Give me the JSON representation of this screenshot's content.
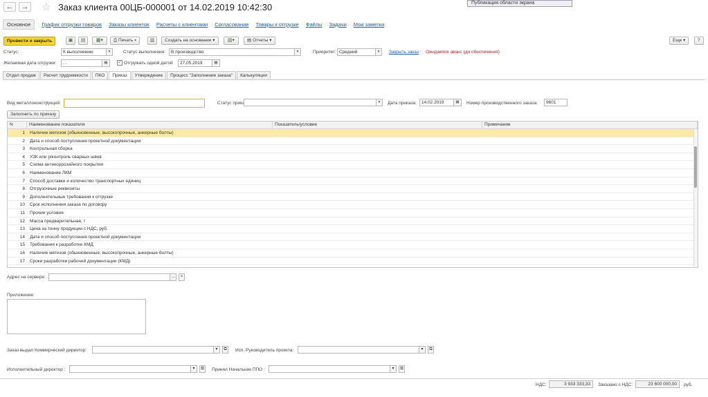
{
  "popup": {
    "text": "Публикация области экрана"
  },
  "window": {
    "title": "Заказ клиента 00ЦБ-000001 от 14.02.2019 10:42:30"
  },
  "nav": {
    "back": "←",
    "forward": "→",
    "star": "☆"
  },
  "top_tabs": [
    "Основное",
    "График отгрузки товаров",
    "Заказы клиентов",
    "Расчеты с клиентами",
    "Согласование",
    "Товары к отгрузке",
    "Файлы",
    "Задачи",
    "Мои заметки"
  ],
  "toolbar": {
    "post_close": "Провести и закрыть",
    "print": "Печать",
    "create_based": "Создать на основании",
    "reports": "Отчеты",
    "more": "Еще",
    "help": "?"
  },
  "status_row": {
    "status_label": "Статус:",
    "status_value": "К выполнению",
    "exec_label": "Статус выполнения:",
    "exec_value": "В производство",
    "priority_label": "Приоритет:",
    "priority_value": "Средний",
    "close_link": "Закрыть заказ",
    "warning": "Ожидается аванс (до обеспечения)"
  },
  "date_row": {
    "label": "Желаемая дата отгрузки:",
    "value": ". .",
    "checkbox_label": "Отгружать одной датой",
    "date_value": "27.05.2019"
  },
  "sub_tabs": [
    "Отдел продаж",
    "Расчет трудоемкости",
    "ПКО",
    "Приказ",
    "Утверждение",
    "Процесс \"Заполнение заказа\"",
    "Калькуляции"
  ],
  "order_form": {
    "kind_label": "Вид металлоконструкций:",
    "kind_value": "",
    "status_label": "Статус приказа:",
    "status_value": "",
    "date_label": "Дата приказа:",
    "date_value": "14.02.2019",
    "prod_label": "Номер производственного заказа:",
    "prod_value": "9601",
    "fill_button": "Заполнить по приказу"
  },
  "table": {
    "headers": [
      "N",
      "Наименование показателя",
      "Показатель/условие",
      "Примечание"
    ],
    "rows": [
      {
        "n": "1",
        "name": "Наличие метизов (обыкновенные, высокопрочные, анкерные болты)"
      },
      {
        "n": "2",
        "name": "Дата и способ поступления проектной документации"
      },
      {
        "n": "3",
        "name": "Контрольная сборка"
      },
      {
        "n": "4",
        "name": "УЗК или р/контроль сварных швов"
      },
      {
        "n": "5",
        "name": "Схема антикоррозийного покрытия"
      },
      {
        "n": "6",
        "name": "Наименование ЛКМ"
      },
      {
        "n": "7",
        "name": "Способ доставки и количество транспортных единиц"
      },
      {
        "n": "8",
        "name": "Отгрузочные реквизиты"
      },
      {
        "n": "9",
        "name": "Дополнительные требования к отгрузке"
      },
      {
        "n": "10",
        "name": "Срок исполнения заказа по договору"
      },
      {
        "n": "11",
        "name": "Прочие условия"
      },
      {
        "n": "12",
        "name": "Масса предварительная, т"
      },
      {
        "n": "13",
        "name": "Цена за тонну продукции с НДС, руб."
      },
      {
        "n": "14",
        "name": "Дата и способ поступления проектной документации"
      },
      {
        "n": "15",
        "name": "Требования к разработке КМД"
      },
      {
        "n": "16",
        "name": "Наличие метизов (обыкновенные, высокопрочные, анкерные болты)"
      },
      {
        "n": "17",
        "name": "Сроки разработки рабочей документации (КМД)"
      }
    ]
  },
  "server": {
    "label": "Адрес на сервере:",
    "value": ""
  },
  "attachment": {
    "label": "Приложение:"
  },
  "signers": {
    "commercial_label": "Заказ выдал Коммерческий директор:",
    "pm_label": "Исп. Руководитель проекта:",
    "exec_label": "Исполнительный директор :",
    "ppo_label": "Принял Начальник ППО :"
  },
  "totals": {
    "vat_label": "НДС:",
    "vat_value": "3 933 333,33",
    "total_label": "Заказано с НДС:",
    "total_value": "23 600 000,00",
    "currency": "руб."
  }
}
